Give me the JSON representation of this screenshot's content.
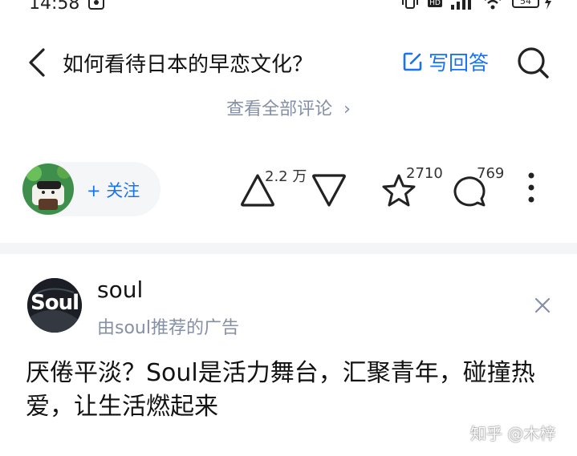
{
  "status_bar": {
    "time": "14:58",
    "battery": "54"
  },
  "header": {
    "title": "如何看待日本的早恋文化？",
    "write_answer_label": "写回答",
    "view_all_comments": "查看全部评论"
  },
  "author": {
    "follow_label": "+ 关注"
  },
  "actions": {
    "upvote_count": "2.2 万",
    "favorite_count": "2710",
    "comment_count": "769"
  },
  "ad": {
    "logo_text": "Soul",
    "name": "soul",
    "subtitle": "由soul推荐的广告",
    "body": "厌倦平淡？Soul是活力舞台，汇聚青年，碰撞热爱，让生活燃起来"
  },
  "watermark": "知乎 @木梓",
  "colors": {
    "accent": "#1772f6",
    "muted": "#8590a6",
    "text": "#121212",
    "divider": "#f4f5f7"
  }
}
